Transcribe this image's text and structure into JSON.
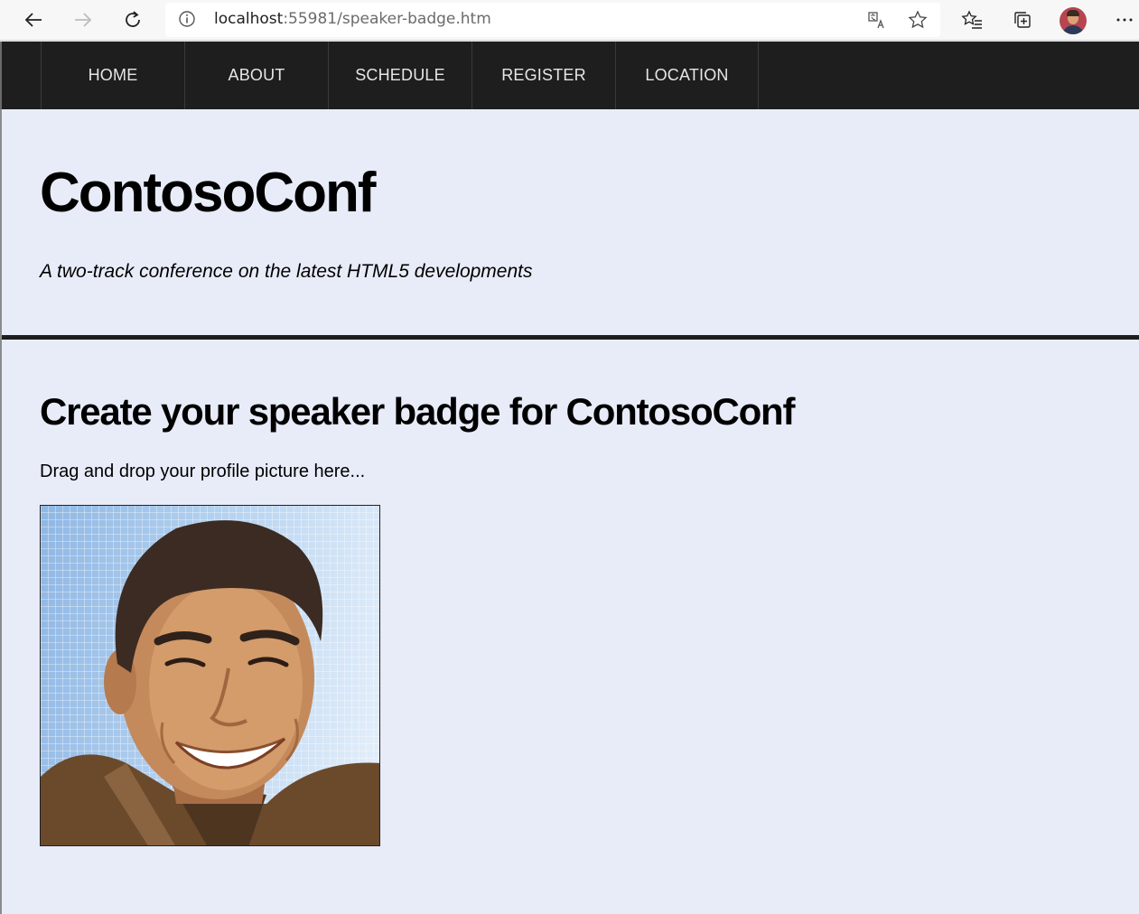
{
  "browser": {
    "url_host": "localhost",
    "url_rest": ":55981/speaker-badge.htm"
  },
  "nav": {
    "items": [
      {
        "label": "HOME"
      },
      {
        "label": "ABOUT"
      },
      {
        "label": "SCHEDULE"
      },
      {
        "label": "REGISTER"
      },
      {
        "label": "LOCATION"
      }
    ]
  },
  "header": {
    "title": "ContosoConf",
    "tagline": "A two-track conference on the latest HTML5 developments"
  },
  "main": {
    "heading": "Create your speaker badge for ContosoConf",
    "drop_hint": "Drag and drop your profile picture here..."
  },
  "icons": {
    "back": "back-arrow-icon",
    "forward": "forward-arrow-icon",
    "refresh": "refresh-icon",
    "info": "info-icon",
    "translate": "translate-icon",
    "favorite": "star-icon",
    "favorites_list": "favorites-list-icon",
    "collections": "collections-icon",
    "menu": "more-icon"
  }
}
